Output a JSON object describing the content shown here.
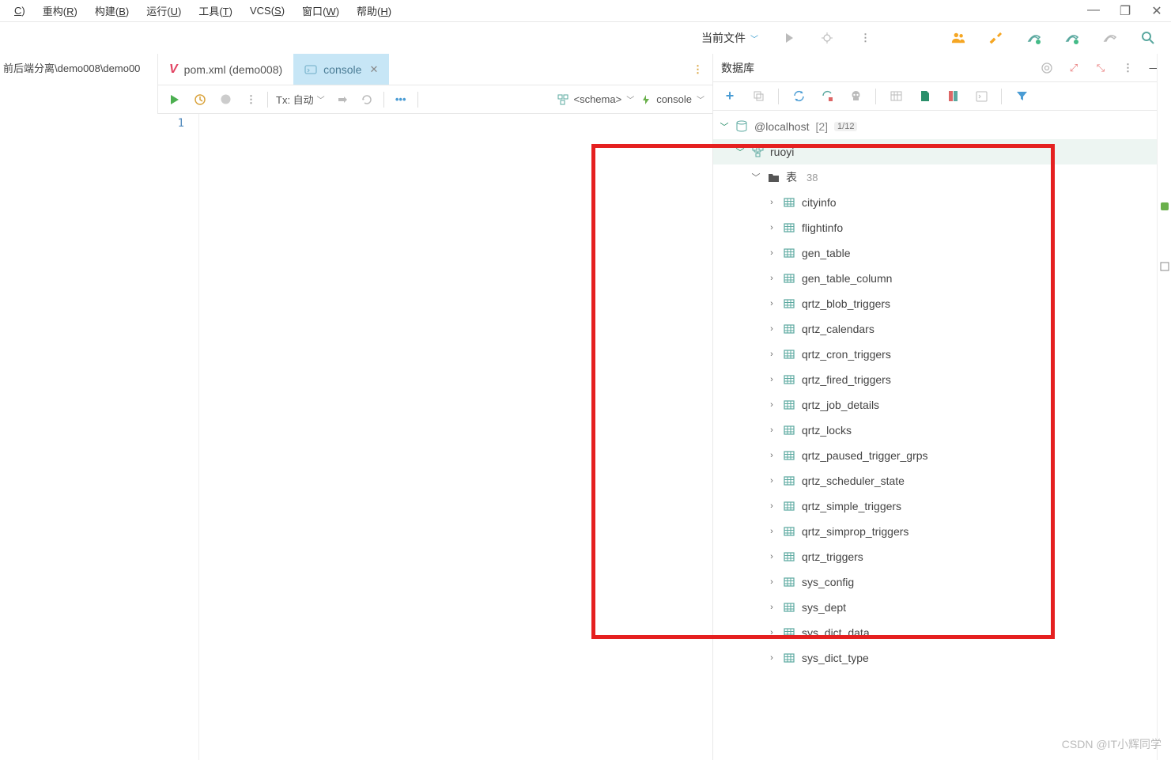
{
  "menubar": {
    "items": [
      {
        "label": "重构",
        "key": "R"
      },
      {
        "label": "构建",
        "key": "B"
      },
      {
        "label": "运行",
        "key": "U"
      },
      {
        "label": "工具",
        "key": "T"
      },
      {
        "label": "VCS",
        "key": "S"
      },
      {
        "label": "窗口",
        "key": "W"
      },
      {
        "label": "帮助",
        "key": "H"
      }
    ],
    "leading_key": "C"
  },
  "topbar": {
    "current_file_label": "当前文件"
  },
  "breadcrumb": "前后端分离\\demo008\\demo00",
  "tabs": [
    {
      "label": "pom.xml (demo008)",
      "icon": "v",
      "active": false
    },
    {
      "label": "console",
      "icon": "console",
      "active": true
    }
  ],
  "editor_toolbar": {
    "tx_label": "Tx: 自动",
    "schema_label": "<schema>",
    "console_label": "console"
  },
  "gutter_line": "1",
  "db_panel": {
    "title": "数据库",
    "connection": {
      "name": "@localhost",
      "suffix": "[2]",
      "tag": "1/12"
    },
    "schema": "ruoyi",
    "tables_label": "表",
    "tables_count": "38",
    "tables": [
      "cityinfo",
      "flightinfo",
      "gen_table",
      "gen_table_column",
      "qrtz_blob_triggers",
      "qrtz_calendars",
      "qrtz_cron_triggers",
      "qrtz_fired_triggers",
      "qrtz_job_details",
      "qrtz_locks",
      "qrtz_paused_trigger_grps",
      "qrtz_scheduler_state",
      "qrtz_simple_triggers",
      "qrtz_simprop_triggers",
      "qrtz_triggers",
      "sys_config",
      "sys_dept",
      "sys_dict_data",
      "sys_dict_type"
    ]
  },
  "watermark": "CSDN @IT小辉同学"
}
